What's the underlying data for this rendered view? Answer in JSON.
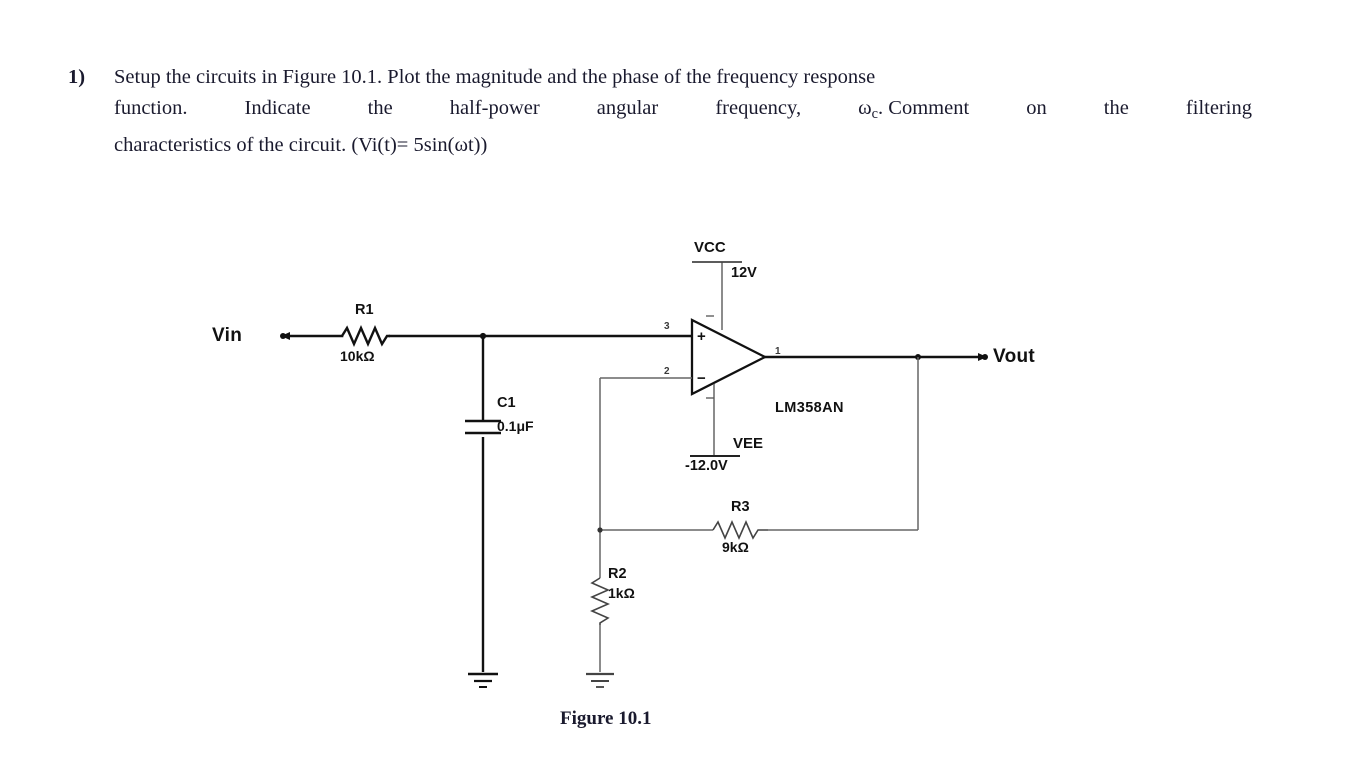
{
  "question": {
    "number": "1)",
    "line1": "Setup the circuits in Figure 10.1. Plot the magnitude and the phase of the frequency response",
    "line2_a": "function.",
    "line2_b": "Indicate",
    "line2_c": "the",
    "line2_d": "half-power",
    "line2_e": "angular",
    "line2_f": "frequency,",
    "line2_g": "ω",
    "line2_g_sub": "c",
    "line2_h": ". Comment",
    "line2_i": "on",
    "line2_j": "the",
    "line2_k": "filtering",
    "line3": "characteristics of the circuit. (Vi(t)= 5sin(ωt))"
  },
  "figure": {
    "caption": "Figure 10.1",
    "input_label": "Vin",
    "output_label": "Vout",
    "opamp": {
      "part_number": "LM358AN",
      "pin_noninverting": "3",
      "pin_inverting": "2",
      "pin_output": "1",
      "plus_sign": "+",
      "minus_sign": "−"
    },
    "rails": {
      "vcc_name": "VCC",
      "vcc_value": "12V",
      "vee_name": "VEE",
      "vee_value": "-12.0V"
    },
    "components": [
      {
        "ref": "R1",
        "value": "10kΩ"
      },
      {
        "ref": "C1",
        "value": "0.1μF"
      },
      {
        "ref": "R3",
        "value": "9kΩ"
      },
      {
        "ref": "R2",
        "value": "1kΩ"
      }
    ],
    "colors": {
      "wire_heavy": "#111111",
      "wire_light": "#666666",
      "text": "#111111",
      "page_text": "#1a1a2e"
    }
  }
}
